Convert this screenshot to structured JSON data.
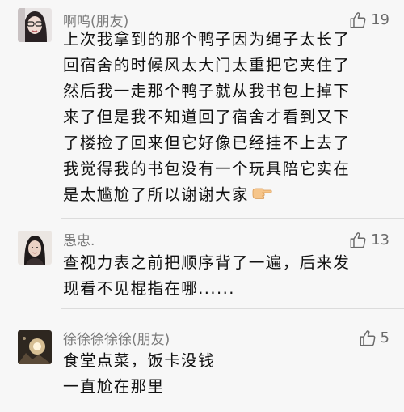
{
  "comments": [
    {
      "name": "啊呜(朋友)",
      "likes": "19",
      "lines": [
        "上次我拿到的那个鸭子因为绳子太长了",
        "回宿舍的时候风太大门太重把它夹住了",
        "然后我一走那个鸭子就从我书包上掉下",
        "来了但是我不知道回了宿舍才看到又下",
        "了楼捡了回来但它好像已经挂不上去了",
        "我觉得我的书包没有一个玩具陪它实在",
        "是太尴尬了所以谢谢大家"
      ],
      "emoji": "pointing-hand-emoji"
    },
    {
      "name": "愚忠.",
      "likes": "13",
      "lines": [
        "查视力表之前把顺序背了一遍，后来发",
        "现看不见棍指在哪......"
      ]
    },
    {
      "name": "徐徐徐徐徐(朋友)",
      "likes": "5",
      "lines": [
        "食堂点菜，饭卡没钱",
        "一直尬在那里"
      ]
    }
  ],
  "icons": {
    "like": "thumbs-up-icon"
  },
  "colors": {
    "background": "#f7f7f7",
    "name": "#7b7b7b",
    "text": "#111111",
    "like": "#6a6a6a"
  }
}
